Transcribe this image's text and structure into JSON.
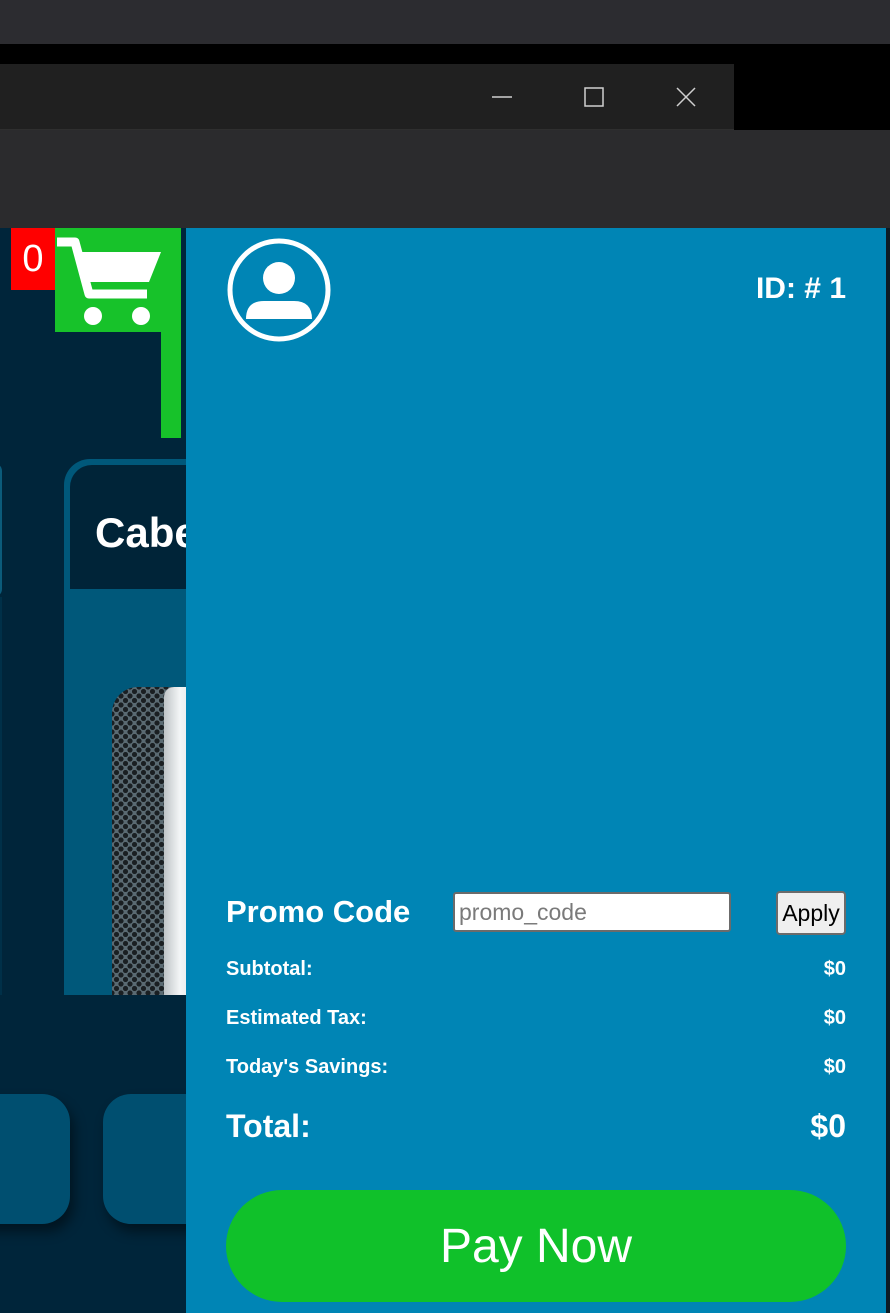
{
  "window": {
    "minimize_icon": "minimize-icon",
    "maximize_icon": "maximize-icon",
    "close_icon": "close-icon"
  },
  "cart": {
    "count": "0",
    "icon": "shopping-cart-icon",
    "color": "#17c22a",
    "badge_color": "#ff0000"
  },
  "background": {
    "product_title": "Cabe"
  },
  "checkout": {
    "avatar_icon": "user-avatar-icon",
    "customer_id": "ID: # 1",
    "promo": {
      "label": "Promo Code",
      "placeholder": "promo_code",
      "value": "",
      "apply_label": "Apply"
    },
    "summary": {
      "subtotal_label": "Subtotal:",
      "subtotal_value": "$0",
      "tax_label": "Estimated Tax:",
      "tax_value": "$0",
      "savings_label": "Today's Savings:",
      "savings_value": "$0",
      "total_label": "Total:",
      "total_value": "$0"
    },
    "pay_label": "Pay Now",
    "panel_color": "#0085b5",
    "pay_color": "#10c12a"
  }
}
